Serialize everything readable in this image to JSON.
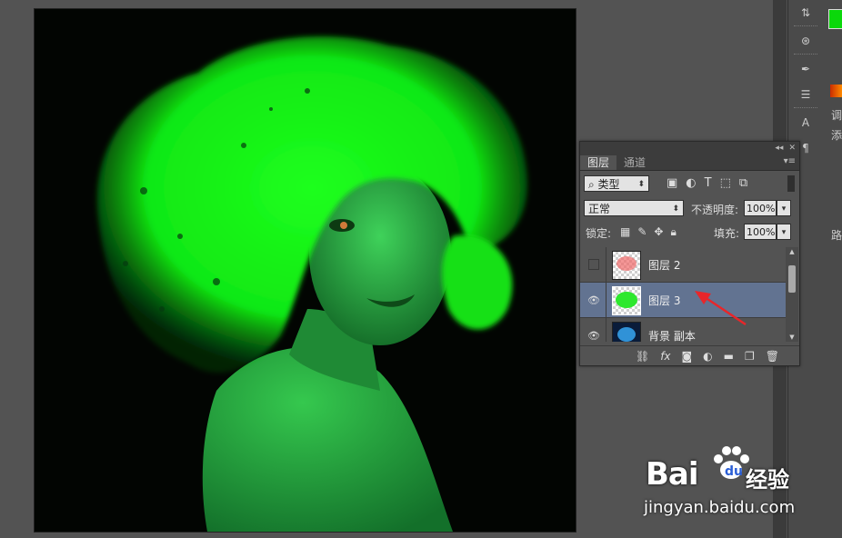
{
  "layers_panel": {
    "tabs": [
      {
        "label": "图层",
        "active": true
      },
      {
        "label": "通道",
        "active": false
      }
    ],
    "top_controls": {
      "collapse": "◂◂",
      "close": "✕"
    },
    "filter": {
      "label": "类型",
      "search_icon": "search-icon"
    },
    "blend_mode": "正常",
    "opacity_label": "不透明度:",
    "opacity_value": "100%",
    "lock_label": "锁定:",
    "fill_label": "填充:",
    "fill_value": "100%",
    "layers": [
      {
        "name": "图层 2",
        "visible": false,
        "selected": false,
        "thumb": "red-hair"
      },
      {
        "name": "图层 3",
        "visible": true,
        "selected": true,
        "thumb": "green-hair"
      },
      {
        "name": "背景 副本",
        "visible": true,
        "selected": false,
        "thumb": "blue-photo"
      }
    ],
    "bottom_icons": [
      "link-icon",
      "fx-icon",
      "mask-icon",
      "adjustment-icon",
      "folder-icon",
      "new-layer-icon",
      "trash-icon"
    ]
  },
  "right_panel": {
    "fg_color": "#0bd80b",
    "side_labels": [
      "调",
      "添",
      "路"
    ]
  },
  "watermark": {
    "brand": "Bai",
    "brand_cn": "经验",
    "url": "jingyan.baidu.com"
  },
  "colors": {
    "hair_green": "#14ff14",
    "selection_blue": "#627391",
    "annotation_red": "#e8262a"
  }
}
